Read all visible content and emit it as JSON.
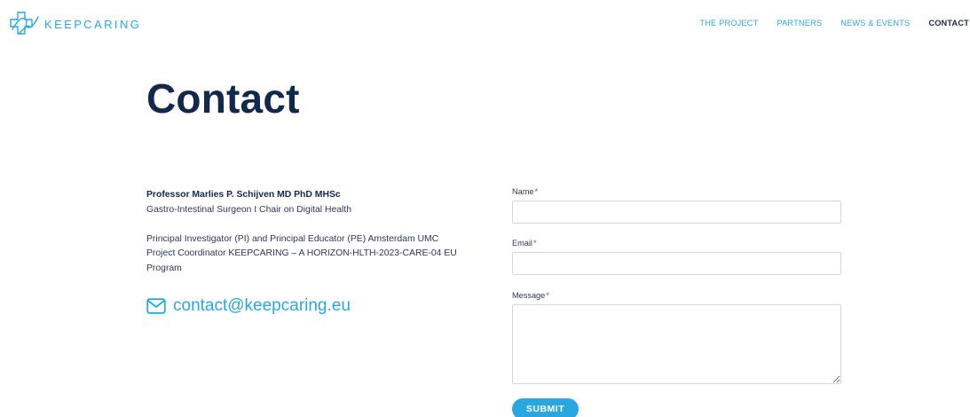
{
  "brand": {
    "name": "KEEPCARING",
    "accent_color": "#29a7e0",
    "dark_color": "#13294b"
  },
  "nav": {
    "items": [
      {
        "label": "THE PROJECT"
      },
      {
        "label": "PARTNERS"
      },
      {
        "label": "NEWS & EVENTS"
      },
      {
        "label": "CONTACT",
        "active": true
      }
    ]
  },
  "page": {
    "title": "Contact"
  },
  "contact_info": {
    "name": "Professor Marlies P. Schijven MD PhD MHSc",
    "role": "Gastro-Intestinal Surgeon I Chair on Digital Health",
    "line1": "Principal Investigator (PI) and Principal Educator (PE) Amsterdam UMC",
    "line2": "Project Coordinator KEEPCARING – A HORIZON-HLTH-2023-CARE-04 EU",
    "line3": "Program",
    "email_icon": "mail-icon",
    "email": "contact@keepcaring.eu"
  },
  "form": {
    "name_label": "Name",
    "email_label": "Email",
    "message_label": "Message",
    "required_marker": "*",
    "name_value": "",
    "email_value": "",
    "message_value": "",
    "submit_label": "SUBMIT"
  }
}
